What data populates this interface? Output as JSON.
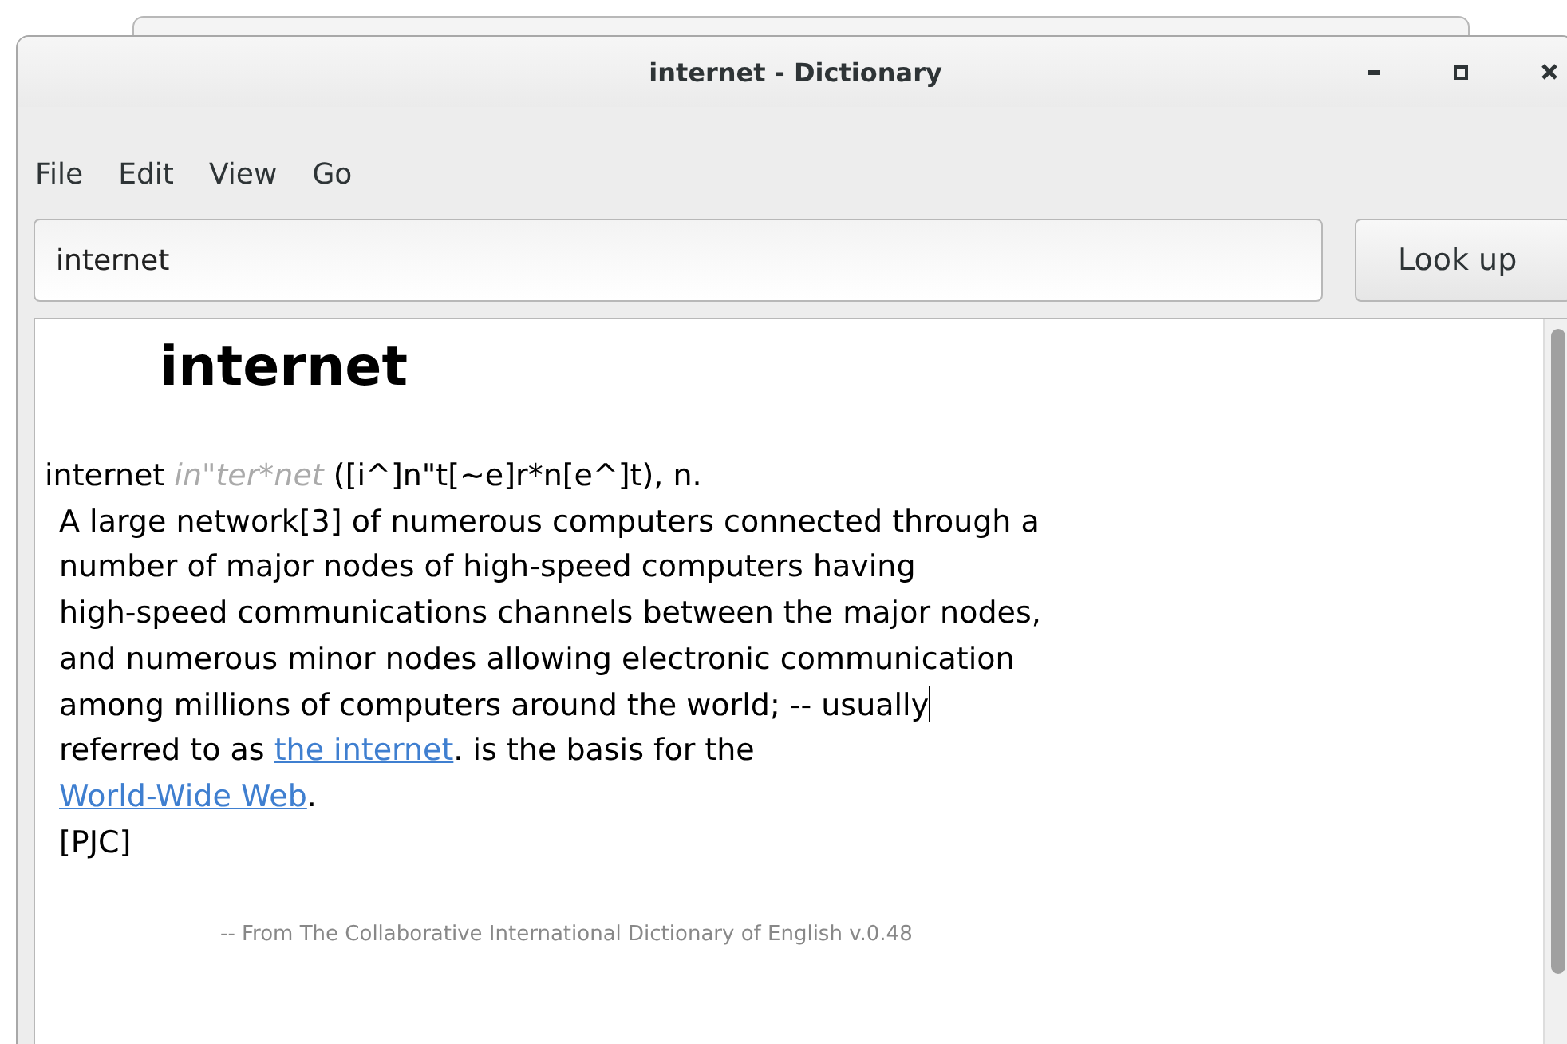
{
  "window": {
    "title": "internet - Dictionary"
  },
  "menu": [
    "File",
    "Edit",
    "View",
    "Go"
  ],
  "search": {
    "value": "internet",
    "button": "Look up"
  },
  "entry": {
    "heading": "internet",
    "lines": [
      [
        {
          "kind": "text",
          "text": "internet "
        },
        {
          "kind": "pron",
          "text": "in\"ter*net"
        },
        {
          "kind": "text",
          "text": " ([i^]n\"t[~e]r*n[e^]t), n."
        }
      ],
      [
        {
          "kind": "text",
          "text": "A large network[3] of numerous computers connected through a"
        }
      ],
      [
        {
          "kind": "text",
          "text": "number of major nodes of high-speed computers having"
        }
      ],
      [
        {
          "kind": "text",
          "text": "high-speed communications channels between the major nodes,"
        }
      ],
      [
        {
          "kind": "text",
          "text": "and numerous minor nodes allowing electronic communication"
        }
      ],
      [
        {
          "kind": "text",
          "text": "among millions of computers around the world; -- usually"
        },
        {
          "kind": "cursor"
        }
      ],
      [
        {
          "kind": "text",
          "text": "referred to as "
        },
        {
          "kind": "link",
          "text": "the internet"
        },
        {
          "kind": "text",
          "text": ". is the basis for the"
        }
      ],
      [
        {
          "kind": "link",
          "text": "World-Wide Web"
        },
        {
          "kind": "text",
          "text": "."
        }
      ],
      [
        {
          "kind": "text",
          "text": "[PJC]"
        }
      ]
    ],
    "source": "-- From The Collaborative International Dictionary of English v.0.48"
  }
}
